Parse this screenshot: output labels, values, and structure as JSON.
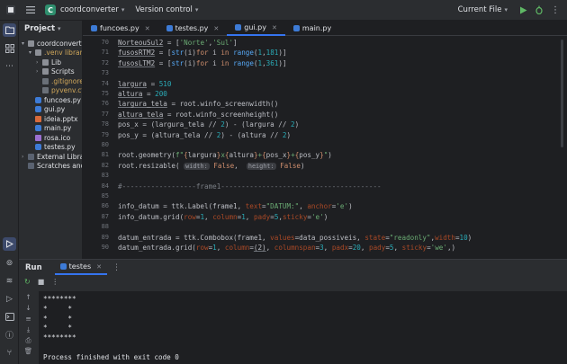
{
  "titlebar": {
    "project_badge": "C",
    "project_name": "coordconverter",
    "vcs": "Version control",
    "run_config": "Current File"
  },
  "project_panel": {
    "title": "Project",
    "items": [
      {
        "label": "coordconvert",
        "type": "folder",
        "indent": 0,
        "expanded": true
      },
      {
        "label": ".venv library",
        "type": "folder",
        "indent": 1,
        "expanded": true
      },
      {
        "label": "Lib",
        "type": "folder",
        "indent": 2,
        "expanded": false
      },
      {
        "label": "Scripts",
        "type": "folder",
        "indent": 2,
        "expanded": false
      },
      {
        "label": ".gitignore",
        "type": "cfg",
        "indent": 2
      },
      {
        "label": "pyvenv.cfg",
        "type": "cfg",
        "indent": 2
      },
      {
        "label": "funcoes.py",
        "type": "py",
        "indent": 1
      },
      {
        "label": "gui.py",
        "type": "py",
        "indent": 1
      },
      {
        "label": "ideia.pptx",
        "type": "ppt",
        "indent": 1
      },
      {
        "label": "main.py",
        "type": "py",
        "indent": 1
      },
      {
        "label": "rosa.ico",
        "type": "ico",
        "indent": 1
      },
      {
        "label": "testes.py",
        "type": "py",
        "indent": 1
      },
      {
        "label": "External Librarie",
        "type": "lib",
        "indent": 0,
        "expanded": false
      },
      {
        "label": "Scratches and",
        "type": "lib",
        "indent": 0
      }
    ]
  },
  "tabs": [
    {
      "label": "funcoes.py"
    },
    {
      "label": "testes.py"
    },
    {
      "label": "gui.py",
      "active": true
    },
    {
      "label": "main.py"
    }
  ],
  "editor": {
    "lines": [
      {
        "n": "70",
        "html": "<span class=\"und\">NorteouSul2</span> = [<span class=\"str\">'Norte'</span>,<span class=\"str\">'Sul'</span>]"
      },
      {
        "n": "71",
        "html": "<span class=\"und\">fusosRTM2</span> = [<span class=\"fn\">str</span>(i)<span class=\"kw\">for</span> i <span class=\"kw\">in</span> <span class=\"fn\">range</span>(<span class=\"num\">1</span>,<span class=\"num\">181</span>)]"
      },
      {
        "n": "72",
        "html": "<span class=\"und\">fusosLTM2</span> = [<span class=\"fn\">str</span>(i)<span class=\"kw\">for</span> i <span class=\"kw\">in</span> <span class=\"fn\">range</span>(<span class=\"num\">1</span>,<span class=\"num\">361</span>)]"
      },
      {
        "n": "73",
        "html": ""
      },
      {
        "n": "74",
        "html": "<span class=\"und\">largura</span> = <span class=\"num\">510</span>"
      },
      {
        "n": "75",
        "html": "<span class=\"und\">altura</span> = <span class=\"num\">200</span>"
      },
      {
        "n": "76",
        "html": "<span class=\"und\">largura_tela</span> = root.winfo_screenwidth()"
      },
      {
        "n": "77",
        "html": "<span class=\"und\">altura_tela</span> = root.winfo_screenheight()"
      },
      {
        "n": "78",
        "html": "pos_x = (largura_tela // <span class=\"num\">2</span>) - (largura // <span class=\"num\">2</span>)"
      },
      {
        "n": "79",
        "html": "pos_y = (altura_tela // <span class=\"num\">2</span>) - (altura // <span class=\"num\">2</span>)"
      },
      {
        "n": "80",
        "html": ""
      },
      {
        "n": "81",
        "html": "root.geometry(<span class=\"str\">f\"</span><span class=\"kw\">{</span>largura<span class=\"kw\">}</span><span class=\"str\">x</span><span class=\"kw\">{</span>altura<span class=\"kw\">}</span><span class=\"str\">+</span><span class=\"kw\">{</span>pos_x<span class=\"kw\">}</span><span class=\"str\">+</span><span class=\"kw\">{</span>pos_y<span class=\"kw\">}</span><span class=\"str\">\"</span>)"
      },
      {
        "n": "82",
        "html": "root.resizable( <span class=\"hint\">width:</span> <span class=\"kw\">False</span>,  <span class=\"hint\">height:</span> <span class=\"kw\">False</span>)"
      },
      {
        "n": "83",
        "html": ""
      },
      {
        "n": "84",
        "html": "<span class=\"cmt\">#------------------frame1---------------------------------------</span>"
      },
      {
        "n": "85",
        "html": ""
      },
      {
        "n": "86",
        "html": "info_datum = ttk.Label(frame1, <span class=\"par\">text</span>=<span class=\"str\">\"DATUM:\"</span>, <span class=\"par\">anchor</span>=<span class=\"str\">'e'</span>)"
      },
      {
        "n": "87",
        "html": "info_datum.grid(<span class=\"par\">row</span>=<span class=\"num\">1</span>, <span class=\"par\">column</span>=<span class=\"num\">1</span>, <span class=\"par\">pady</span>=<span class=\"num\">5</span>,<span class=\"par\">sticky</span>=<span class=\"str\">'e'</span>)"
      },
      {
        "n": "88",
        "html": ""
      },
      {
        "n": "89",
        "html": "datum_entrada = ttk.Combobox(frame1, <span class=\"par\">values</span>=data_possiveis, <span class=\"par\">state</span>=<span class=\"str\">\"readonly\"</span>,<span class=\"par\">width</span>=<span class=\"num\">10</span>)"
      },
      {
        "n": "90",
        "html": "datum_entrada.grid(<span class=\"par\">row</span>=<span class=\"num\">1</span>, <span class=\"par\">column</span>=<span class=\"und\">(2)</span>, <span class=\"par\">columnspan</span>=<span class=\"num\">3</span>, <span class=\"par\">padx</span>=<span class=\"num\">20</span>, <span class=\"par\">pady</span>=<span class=\"num\">5</span>, <span class=\"par\">sticky</span>=<span class=\"str\">'we'</span>,)"
      }
    ]
  },
  "run": {
    "title": "Run",
    "tab_label": "testes",
    "console": [
      "********",
      "*     *",
      "*     *",
      "*     *",
      "********",
      "",
      "Process finished with exit code 0"
    ]
  },
  "colors": {
    "accent": "#3574f0",
    "run_green": "#5fb865",
    "bg": "#1e1f22",
    "panel": "#2b2d30"
  }
}
